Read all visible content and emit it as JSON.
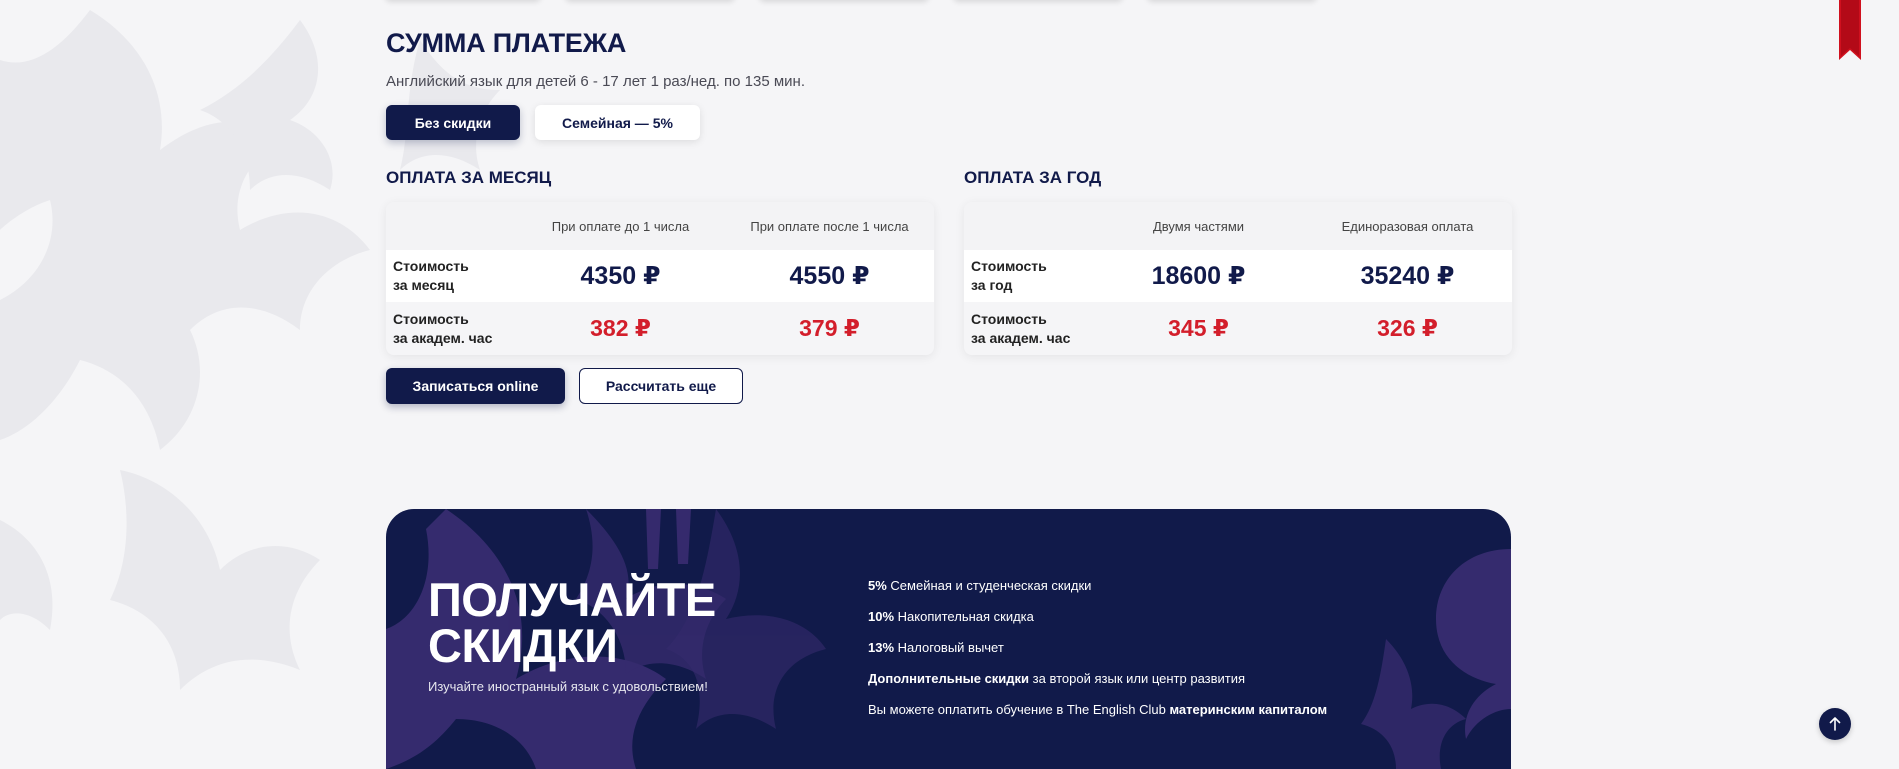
{
  "payment": {
    "title": "СУММА ПЛАТЕЖА",
    "subtitle": "Английский язык для детей 6 - 17 лет 1 раз/нед. по 135 мин.",
    "discount_tabs": [
      {
        "label": "Без скидки",
        "active": true
      },
      {
        "label": "Семейная — 5%",
        "active": false
      }
    ]
  },
  "monthly": {
    "title": "ОПЛАТА ЗА МЕСЯЦ",
    "columns": [
      "При оплате до 1 числа",
      "При оплате после 1 числа"
    ],
    "rows": [
      {
        "label_line1": "Стоимость",
        "label_line2": "за месяц",
        "values": [
          "4350 ₽",
          "4550 ₽"
        ]
      },
      {
        "label_line1": "Стоимость",
        "label_line2": "за академ. час",
        "values": [
          "382 ₽",
          "379 ₽"
        ]
      }
    ]
  },
  "yearly": {
    "title": "ОПЛАТА ЗА ГОД",
    "columns": [
      "Двумя частями",
      "Единоразовая оплата"
    ],
    "rows": [
      {
        "label_line1": "Стоимость",
        "label_line2": "за год",
        "values": [
          "18600 ₽",
          "35240 ₽"
        ]
      },
      {
        "label_line1": "Стоимость",
        "label_line2": "за академ. час",
        "values": [
          "345 ₽",
          "326 ₽"
        ]
      }
    ]
  },
  "actions": {
    "enroll_label": "Записаться online",
    "recalc_label": "Рассчитать еще"
  },
  "banner": {
    "title_line1": "ПОЛУЧАЙТЕ",
    "title_line2": "СКИДКИ",
    "subtitle": "Изучайте иностранный язык с удовольствием!",
    "items": [
      {
        "bold": "5%",
        "text": " Семейная и студенческая скидки"
      },
      {
        "bold": "10%",
        "text": " Накопительная скидка"
      },
      {
        "bold": "13%",
        "text": " Налоговый вычет"
      },
      {
        "bold": "Дополнительные скидки",
        "text": " за второй язык или центр развития"
      },
      {
        "pre": "Вы можете оплатить обучение в The English Club ",
        "bold": "материнским капиталом"
      }
    ]
  },
  "icons": {
    "bookmark": "bookmark-ribbon-icon",
    "scroll_top": "arrow-up-icon"
  },
  "colors": {
    "navy": "#111a4a",
    "price_red": "#d31e2b",
    "background": "#f5f5f7",
    "bookmark_red": "#d0101e"
  }
}
